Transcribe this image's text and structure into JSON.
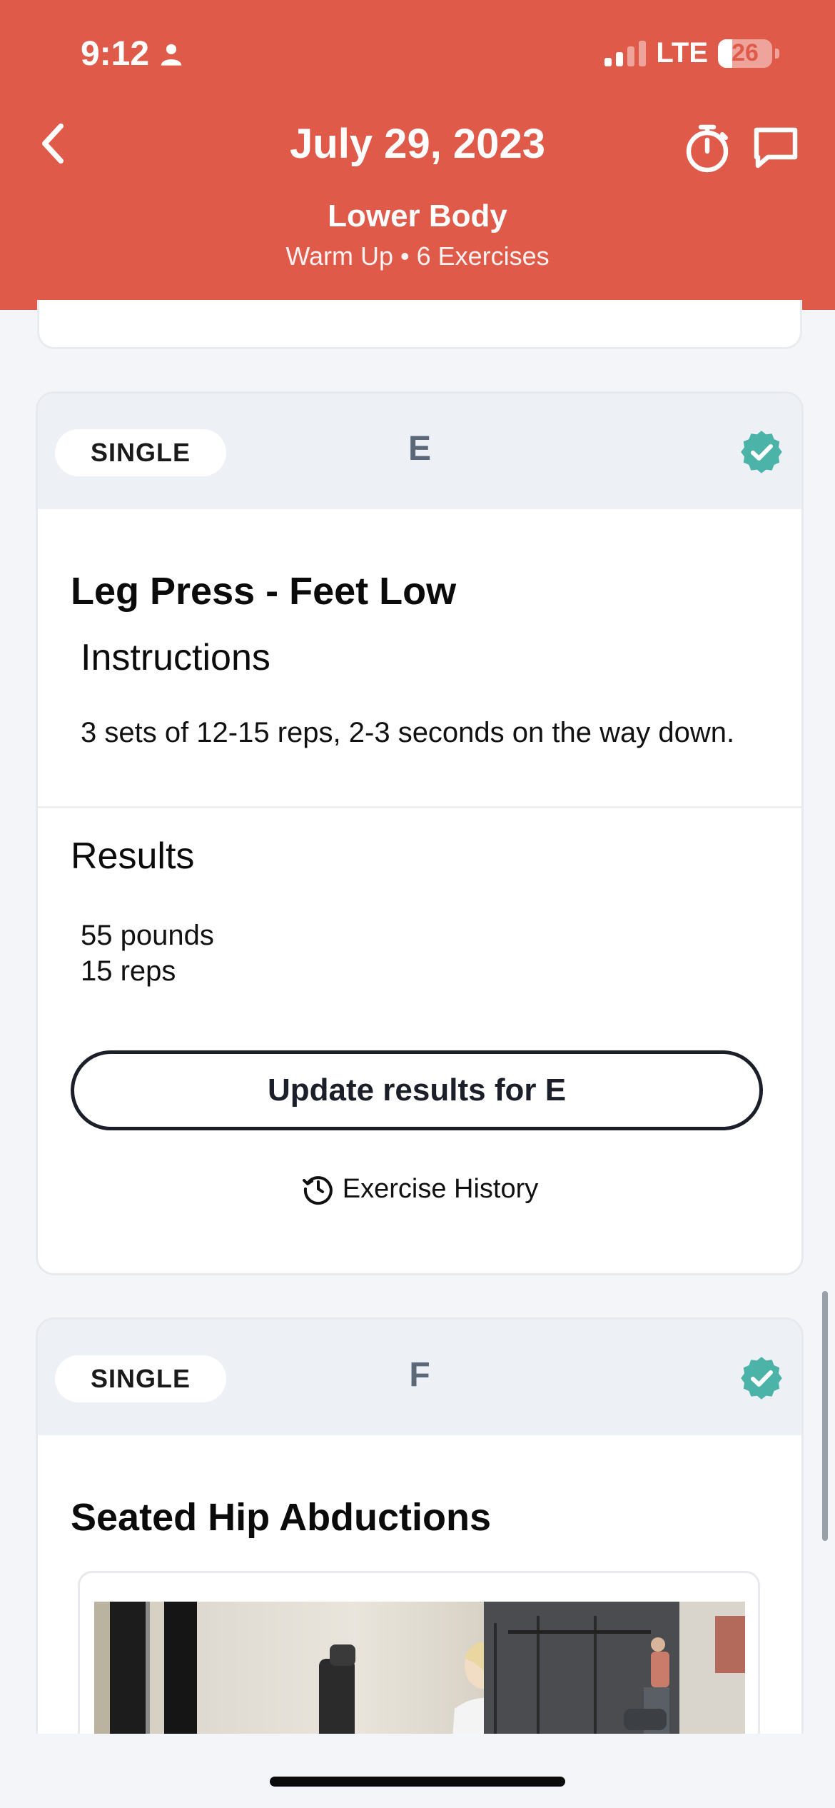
{
  "status_bar": {
    "time": "9:12",
    "network": "LTE",
    "battery": "26",
    "battery_level": 0.26
  },
  "header": {
    "title": "July 29, 2023",
    "workout_name": "Lower Body",
    "workout_meta": "Warm Up • 6 Exercises",
    "icons": [
      "back-chevron-icon",
      "stopwatch-icon",
      "chat-bubble-icon",
      "person-icon"
    ]
  },
  "cards": [
    {
      "type_label": "SINGLE",
      "group_letter": "E",
      "completed": true,
      "exercise_name": "Leg Press - Feet Low",
      "instructions_title": "Instructions",
      "instructions_text": "3 sets of 12-15 reps, 2-3 seconds on the way down.",
      "results_title": "Results",
      "results_line1": "55 pounds",
      "results_line2": "15 reps",
      "update_button": "Update results for E",
      "history_link": "Exercise History"
    },
    {
      "type_label": "SINGLE",
      "group_letter": "F",
      "completed": true,
      "exercise_name": "Seated Hip Abductions"
    }
  ],
  "colors": {
    "header_bg": "#e05a4a",
    "check_badge": "#4bb3a7",
    "card_head_bg": "#edf0f5",
    "page_bg": "#f3f5f8"
  }
}
